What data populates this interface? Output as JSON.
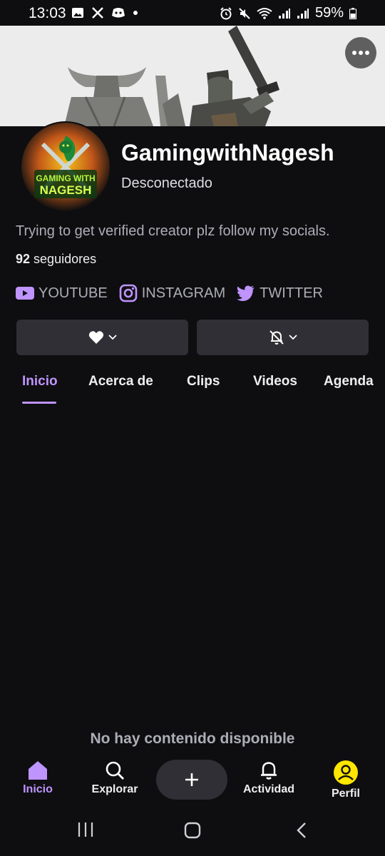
{
  "status_bar": {
    "time": "13:03",
    "battery": "59%",
    "left_icons": [
      "image-icon",
      "x-logo-icon",
      "discord-icon",
      "dot-icon"
    ],
    "right_icons": [
      "alarm-icon",
      "mute-icon",
      "wifi-icon",
      "signal-icon",
      "signal-icon",
      "battery-icon"
    ]
  },
  "banner": {
    "more_button": "more-options-icon"
  },
  "profile": {
    "name": "GamingwithNagesh",
    "status": "Desconectado",
    "bio": "Trying to get verified creator plz follow my socials.",
    "followers_count": "92",
    "followers_label": "seguidores",
    "avatar_text_line1": "GAMING WITH",
    "avatar_text_line2": "NAGESH"
  },
  "socials": [
    {
      "label": "YOUTUBE",
      "icon": "youtube-icon"
    },
    {
      "label": "INSTAGRAM",
      "icon": "instagram-icon"
    },
    {
      "label": "TWITTER",
      "icon": "twitter-icon"
    }
  ],
  "actions": {
    "follow_icon": "heart-icon",
    "notify_icon": "bell-off-icon"
  },
  "tabs": [
    "Inicio",
    "Acerca de",
    "Clips",
    "Videos",
    "Agenda"
  ],
  "active_tab": "Inicio",
  "empty_message": "No hay contenido disponible",
  "bottom_nav": [
    {
      "label": "Inicio",
      "icon": "home-icon",
      "active": true
    },
    {
      "label": "Explorar",
      "icon": "search-icon",
      "active": false
    },
    {
      "label": "",
      "icon": "plus-icon",
      "active": false
    },
    {
      "label": "Actividad",
      "icon": "bell-icon",
      "active": false
    },
    {
      "label": "Perfil",
      "icon": "profile-icon",
      "active": false
    }
  ],
  "colors": {
    "accent": "#bf94ff",
    "background": "#0e0e10",
    "button_bg": "#2f2f35",
    "profile_badge": "#ffe600"
  }
}
